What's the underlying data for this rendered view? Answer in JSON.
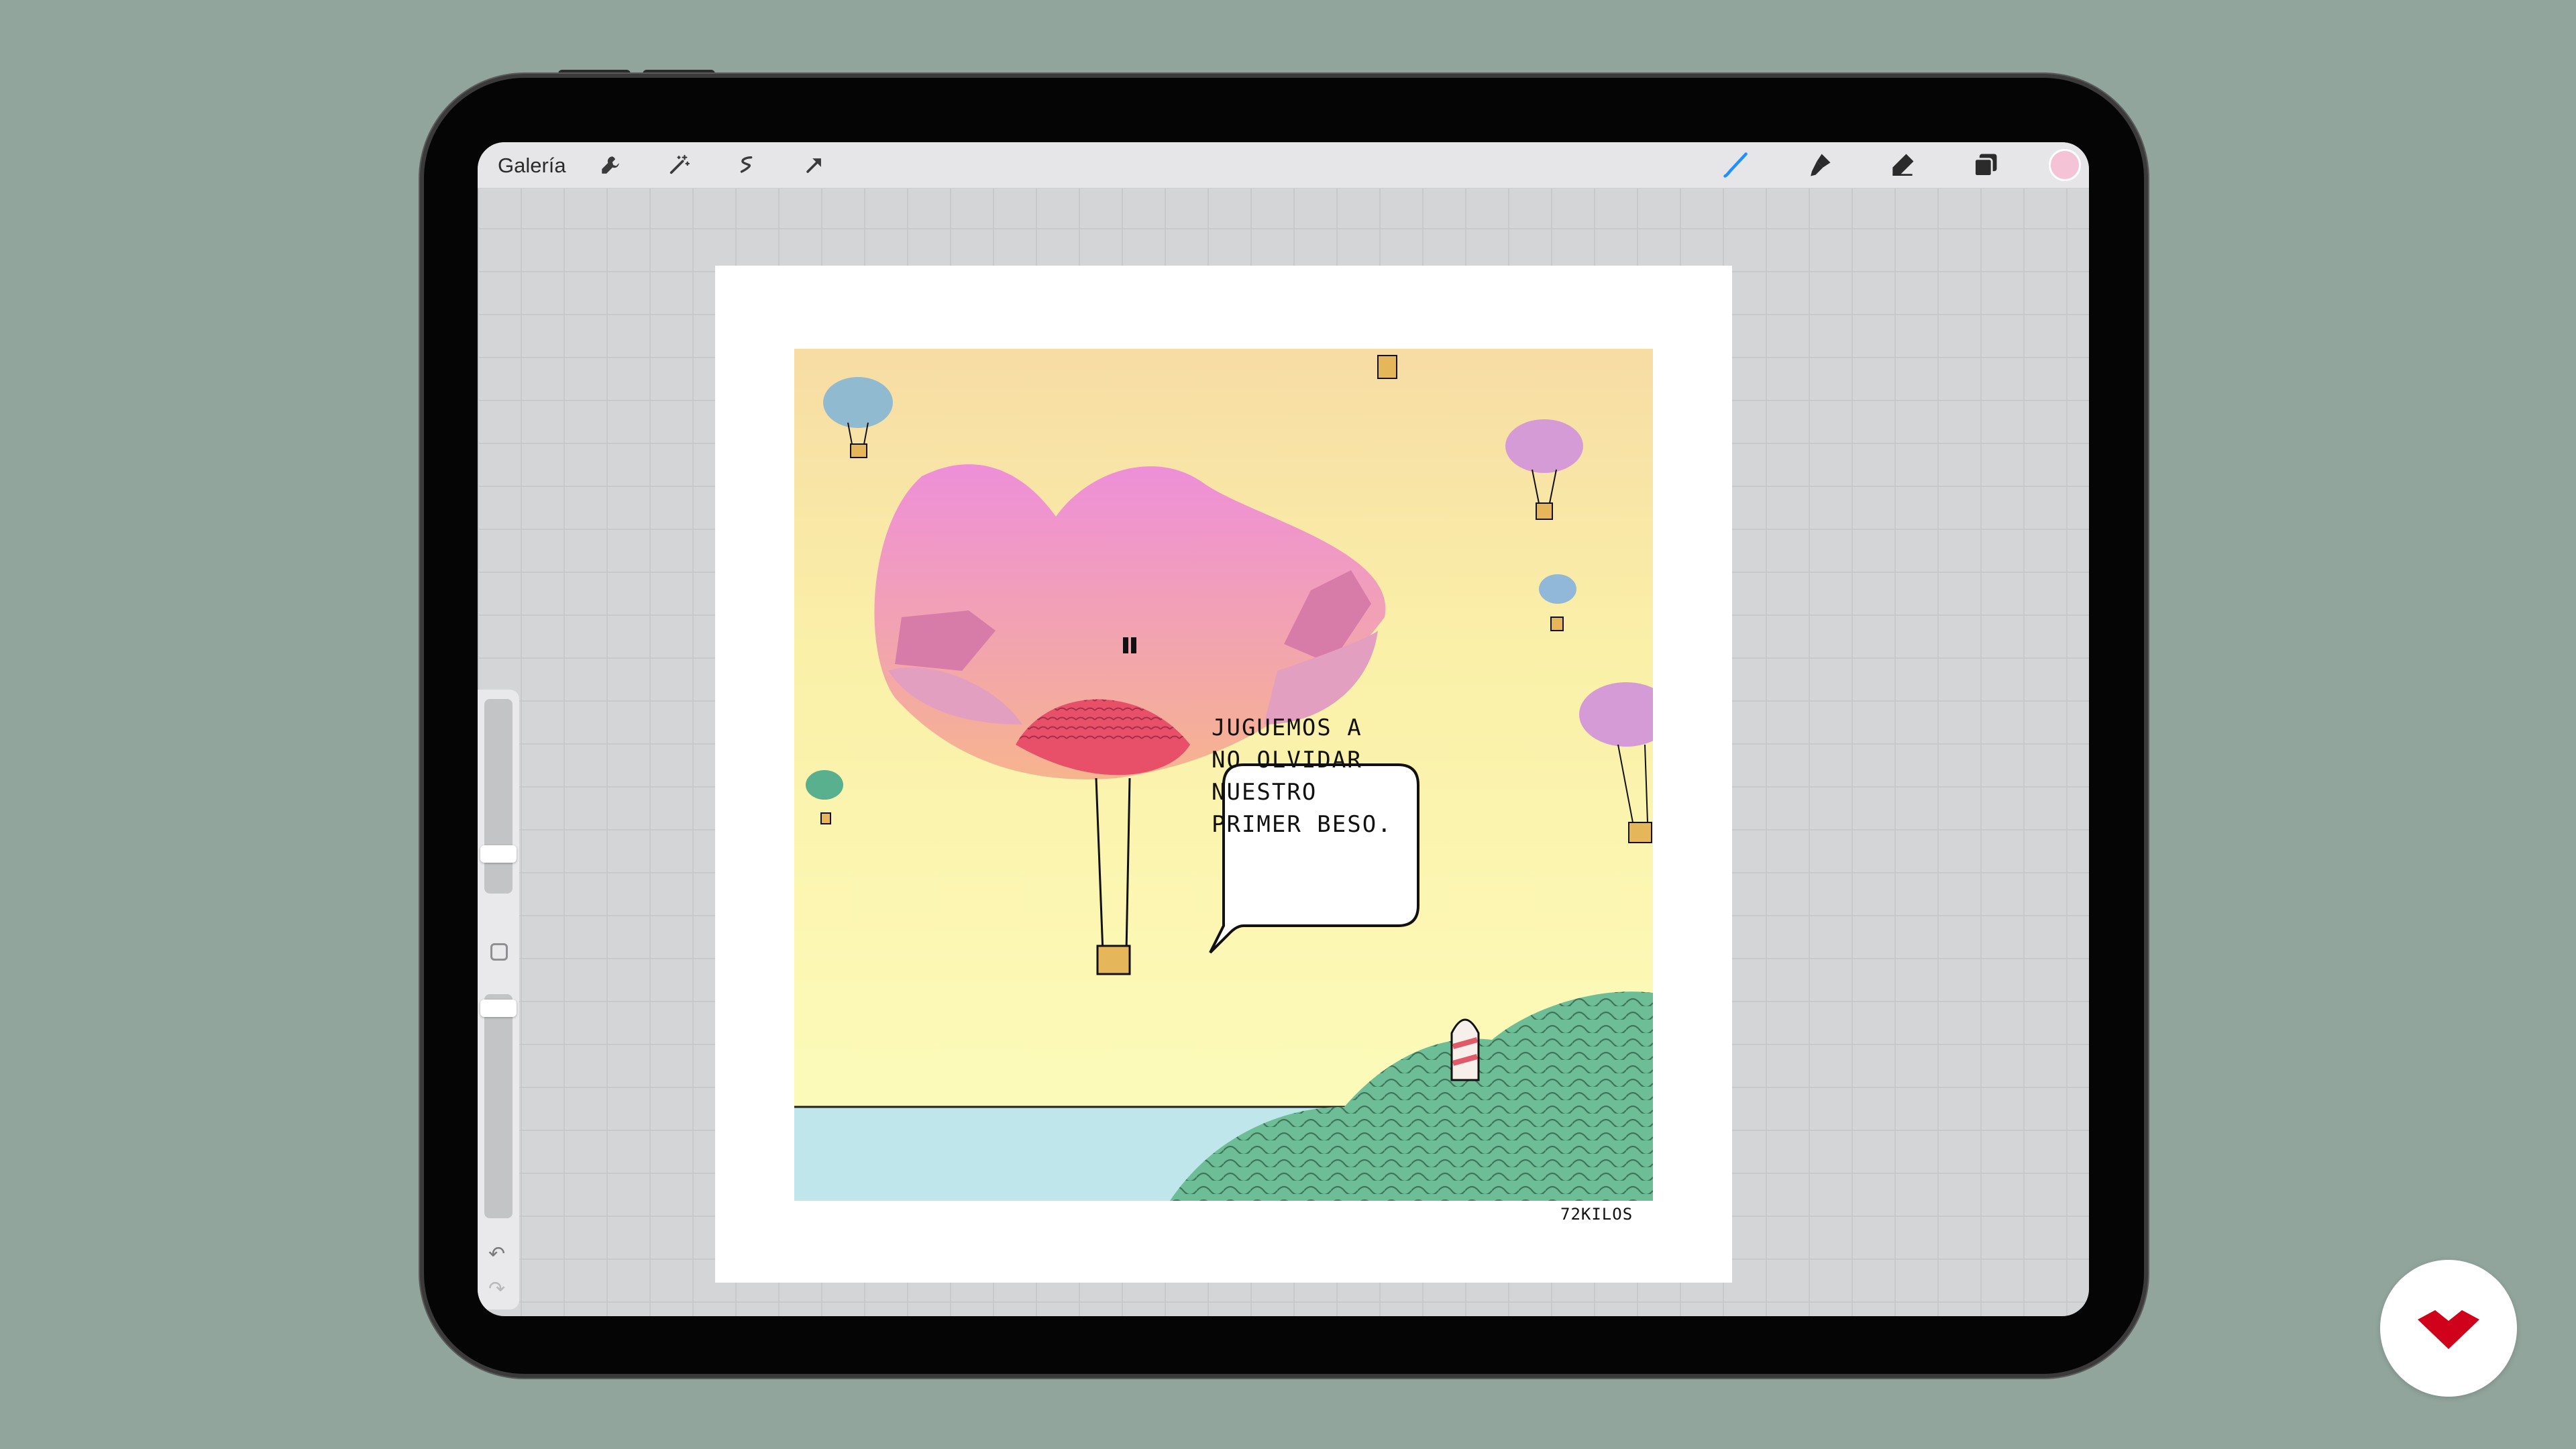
{
  "toolbar": {
    "gallery_label": "Galería",
    "left_tools": [
      "wrench-icon",
      "magic-wand-icon",
      "selection-icon",
      "transform-arrow-icon"
    ],
    "right_tools": [
      "brush-icon",
      "smudge-icon",
      "eraser-icon",
      "layers-icon"
    ],
    "active_color": "#f4c4d6",
    "active_tool_color": "#1e90ff"
  },
  "sidebar": {
    "modify_button": "square-icon",
    "undo": "undo-icon",
    "redo": "redo-icon"
  },
  "artwork": {
    "speech_lines": [
      "JUGUEMOS A",
      "NO OLVIDAR",
      "NUESTRO",
      "PRIMER BESO."
    ],
    "signature": "72KILOS"
  },
  "brand": {
    "logo": "domestika-logo-icon",
    "color": "#d0021b"
  }
}
